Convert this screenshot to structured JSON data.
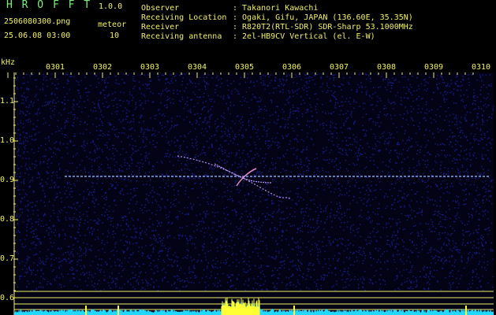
{
  "header": {
    "app_name": "H R O F F T",
    "version": "1.0.0",
    "filename": "2506080300.png",
    "datetime": "25.06.08 03:00",
    "meteor_label": "meteor",
    "meteor_count": "10"
  },
  "info": {
    "labels": [
      "Observer",
      "Receiving Location",
      "Receiver",
      "Receiving antenna"
    ],
    "values": [
      ": Takanori Kawachi",
      ": Ogaki, Gifu, JAPAN (136.60E, 35.35N)",
      ": R820T2(RTL-SDR) SDR-Sharp 53.1000MHz",
      ": 2el-HB9CV Vertical (el. E-W)"
    ]
  },
  "axes": {
    "y_unit": "kHz",
    "x_ticks": [
      "0301",
      "0302",
      "0303",
      "0304",
      "0305",
      "0306",
      "0307",
      "0308",
      "0309",
      "0310"
    ],
    "y_ticks": [
      "1.1",
      "1.0",
      "0.9",
      "0.8",
      "0.7",
      "0.6"
    ]
  },
  "colors": {
    "background": "#000000",
    "header_text": "#7cf07a",
    "axis_text": "#f2f064",
    "noise": "#1a22a0",
    "carrier": "#8fb8ff",
    "echo": "#c8a0ff",
    "histogram": "#22d8ff",
    "histogram_peak": "#ffff33"
  }
}
